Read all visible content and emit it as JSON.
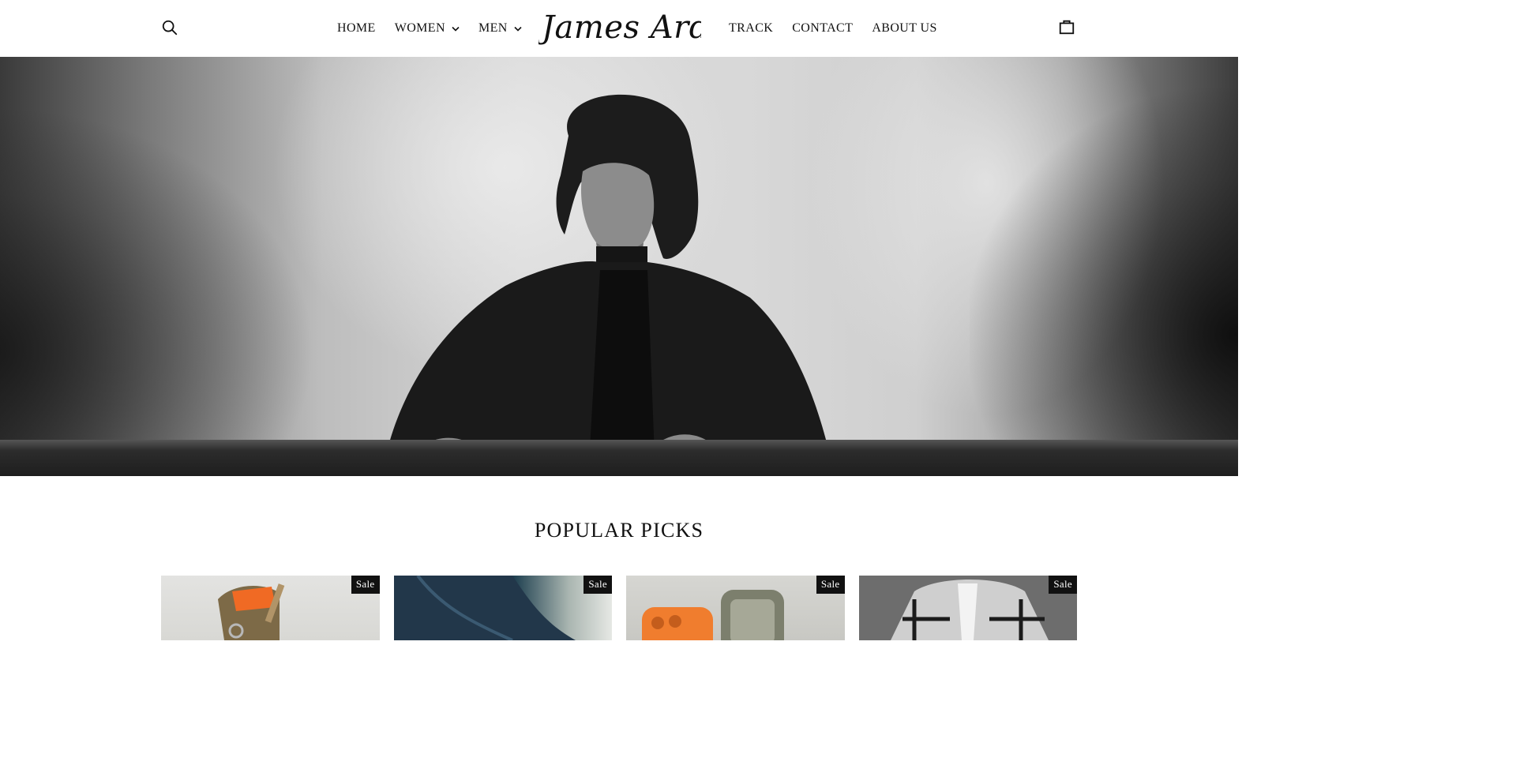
{
  "header": {
    "logo_text": "James Ardon",
    "nav_left": [
      {
        "label": "HOME",
        "has_dropdown": false
      },
      {
        "label": "WOMEN",
        "has_dropdown": true
      },
      {
        "label": "MEN",
        "has_dropdown": true
      }
    ],
    "nav_right": [
      {
        "label": "TRACK"
      },
      {
        "label": "CONTACT"
      },
      {
        "label": "ABOUT US"
      }
    ],
    "search_icon": "search-icon",
    "cart_icon": "shopping-bag-icon"
  },
  "hero": {
    "image": "black-and-white photo of young man in dark coat and turtleneck leaning back"
  },
  "popular": {
    "title": "POPULAR PICKS",
    "products": [
      {
        "badge": "Sale",
        "image": "orange and olive bucket bag"
      },
      {
        "badge": "Sale",
        "image": "denim jeans close-up"
      },
      {
        "badge": "Sale",
        "image": "orange and olive phone cases"
      },
      {
        "badge": "Sale",
        "image": "grey plaid shawl-collar cardigan"
      }
    ]
  },
  "colors": {
    "text": "#111111",
    "background": "#ffffff",
    "badge_bg": "#111111",
    "badge_text": "#ffffff"
  }
}
